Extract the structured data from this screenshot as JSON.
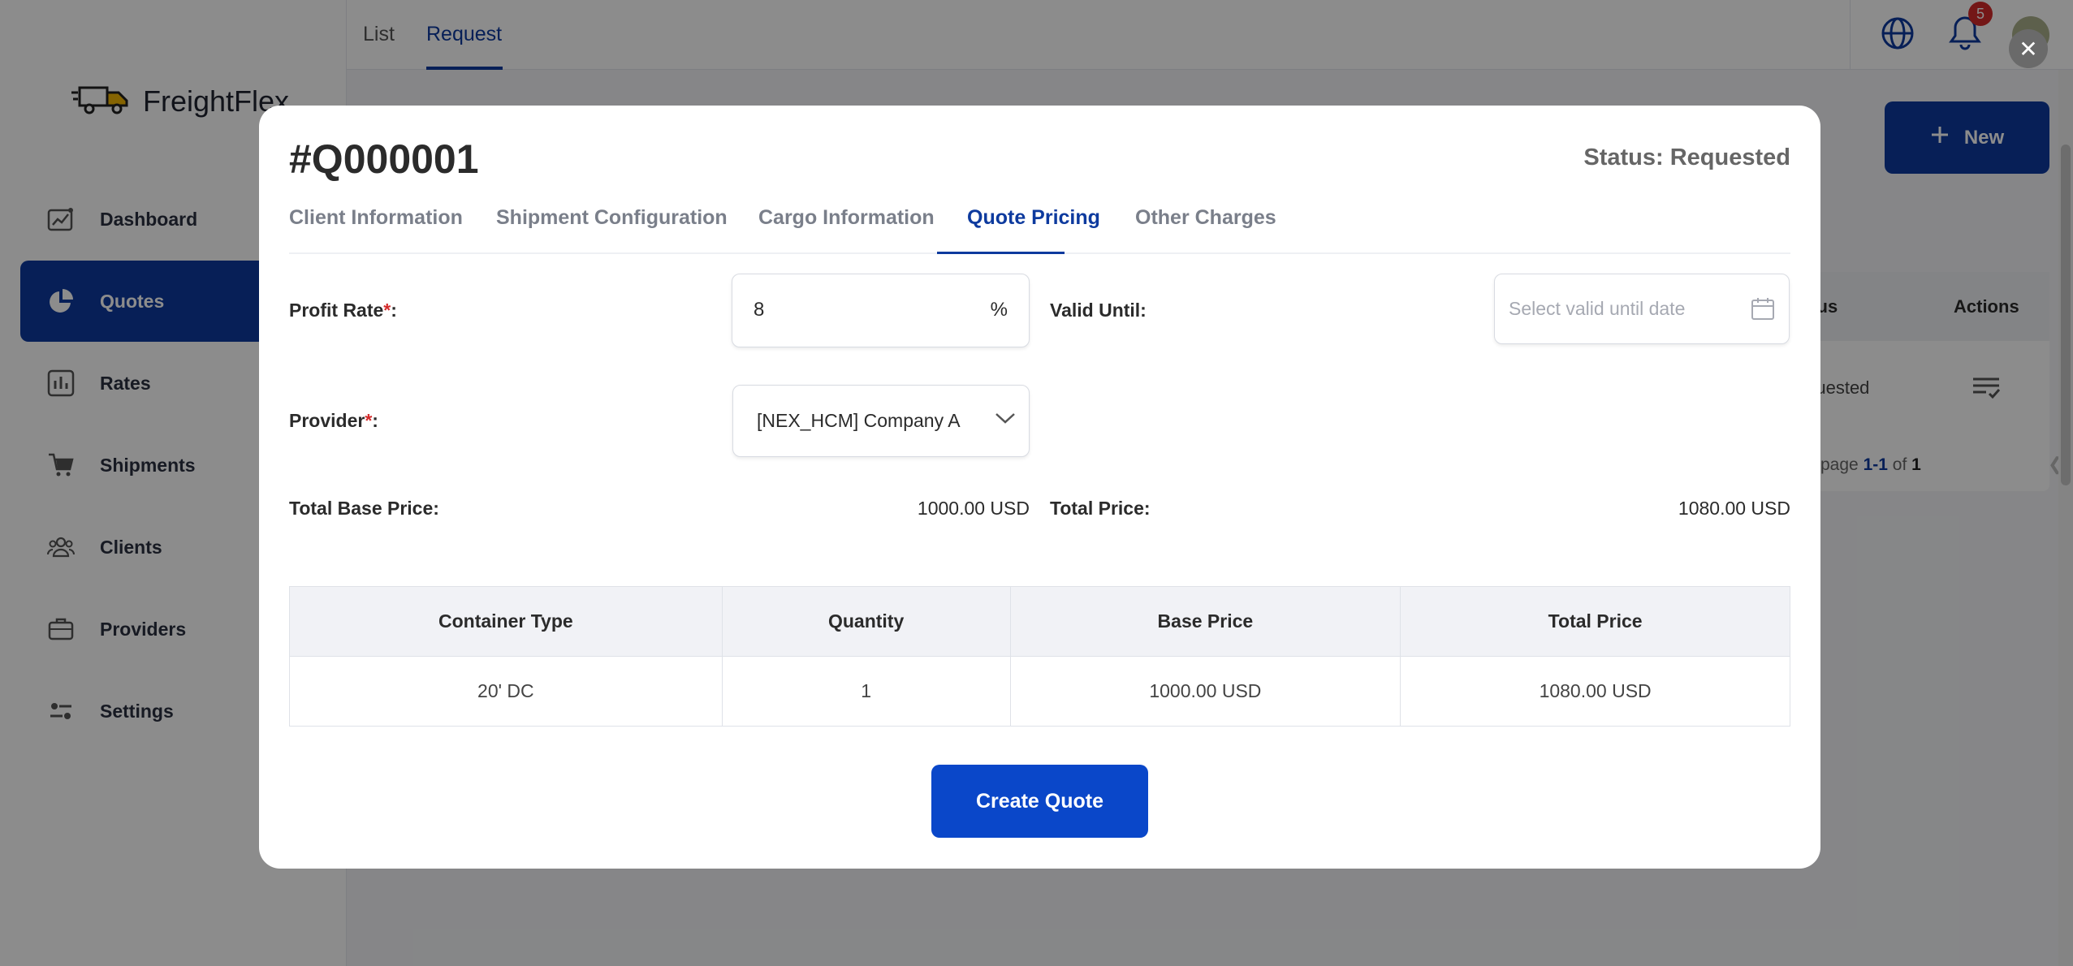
{
  "app": {
    "name": "FreightFlex"
  },
  "sidebar": {
    "items": [
      {
        "label": "Dashboard",
        "icon": "chart-up-icon"
      },
      {
        "label": "Quotes",
        "icon": "pie-chart-icon",
        "active": true
      },
      {
        "label": "Rates",
        "icon": "bar-chart-icon"
      },
      {
        "label": "Shipments",
        "icon": "cart-icon"
      },
      {
        "label": "Clients",
        "icon": "users-icon"
      },
      {
        "label": "Providers",
        "icon": "briefcase-icon"
      },
      {
        "label": "Settings",
        "icon": "sliders-icon"
      }
    ]
  },
  "header": {
    "tabs": [
      {
        "label": "List"
      },
      {
        "label": "Request",
        "active": true
      }
    ],
    "notifications_count": "5"
  },
  "page": {
    "new_button": "New",
    "table": {
      "status_header": "Status",
      "actions_header": "Actions",
      "row_status": "Requested"
    },
    "pagination": {
      "prefix": "page",
      "range_start": "1",
      "range_sep": "-",
      "range_end": "1",
      "of": "of",
      "total": "1"
    }
  },
  "modal": {
    "title": "#Q000001",
    "status": "Status: Requested",
    "tabs": [
      {
        "label": "Client Information"
      },
      {
        "label": "Shipment Configuration"
      },
      {
        "label": "Cargo Information"
      },
      {
        "label": "Quote Pricing",
        "active": true
      },
      {
        "label": "Other Charges"
      }
    ],
    "form": {
      "profit_rate_label": "Profit Rate",
      "profit_rate_value": "8",
      "profit_rate_unit": "%",
      "valid_until_label": "Valid Until:",
      "valid_until_placeholder": "Select valid until date",
      "provider_label": "Provider",
      "provider_value": "[NEX_HCM] Company A",
      "total_base_price_label": "Total Base Price:",
      "total_base_price_value": "1000.00 USD",
      "total_price_label": "Total Price:",
      "total_price_value": "1080.00 USD",
      "required_mark": "*",
      "colon": ":"
    },
    "table": {
      "headers": [
        "Container Type",
        "Quantity",
        "Base Price",
        "Total Price"
      ],
      "rows": [
        [
          "20' DC",
          "1",
          "1000.00 USD",
          "1080.00 USD"
        ]
      ]
    },
    "create_button": "Create Quote"
  },
  "colors": {
    "primary": "#0d3a9e",
    "button": "#0a47c9",
    "danger": "#d42b2b"
  }
}
